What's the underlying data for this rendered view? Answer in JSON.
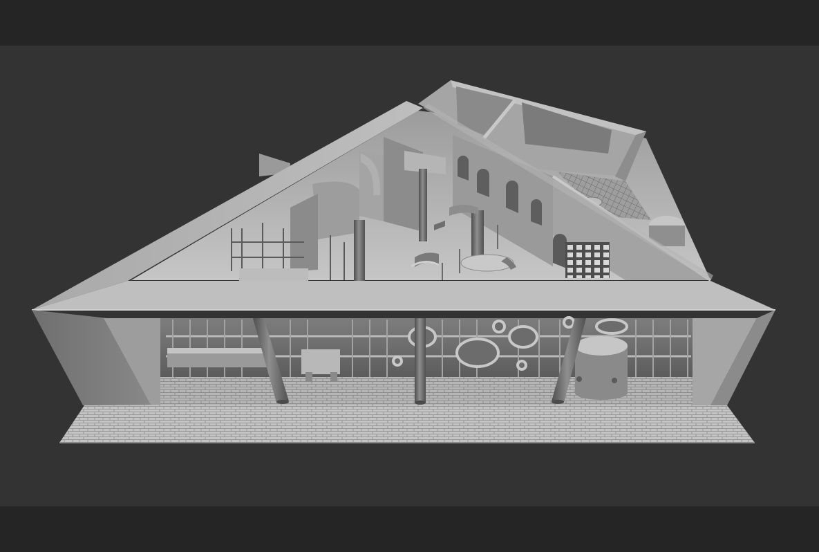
{
  "colors": {
    "letterbox": "#252525",
    "viewport_background": "#333333",
    "model_light": "#bdbdbd",
    "model_mid": "#8f8f8f",
    "model_dark": "#5e5e5e",
    "floor": "#c8c8c8"
  },
  "scene": {
    "subject": "architectural-model-render"
  }
}
